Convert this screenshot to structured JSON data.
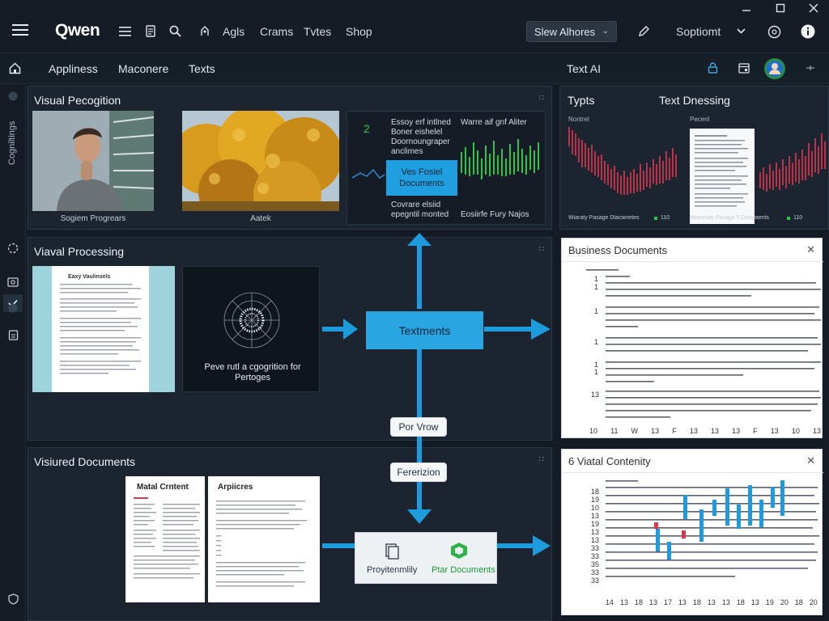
{
  "titlebar": {
    "brand": "Qwen",
    "menu": [
      "Agls",
      "Crams",
      "Tvtes",
      "Shop"
    ],
    "model_select": "Slew Alhores",
    "right_label": "Soptiomt",
    "window_controls": [
      "minimize-icon",
      "maximize-icon",
      "close-icon"
    ]
  },
  "subbar": {
    "tabs": [
      "Appliness",
      "Maconere",
      "Texts"
    ],
    "right_title": "Text AI"
  },
  "rail": {
    "vertical_label": "Cogniltings"
  },
  "panels": {
    "visual_recognition": {
      "title": "Visual Pecogition",
      "captions": [
        "Sogiem Progrears",
        "Aatek"
      ],
      "text_block_1": "Essoy erf intlned Boner eishelel Doornoungraper anclimes",
      "text_block_2": "Warre aif gnf Aliter",
      "highlight": "Ves Fosiel Documents",
      "text_block_3": "Covrare elsiid epegntil monted",
      "text_block_4": "Eosiirfe Fury Najos"
    },
    "types": {
      "title_left": "Typts",
      "title_right": "Text Dnessing",
      "left_header": "Nontrel",
      "right_header": "Pecenl",
      "left_footer": "Wiaraty Pasage Dlacwnetes",
      "right_footer": "Wianrraty Pasage 5 Docwaents",
      "left_footer_num": "110",
      "right_footer_num": "110"
    },
    "visual_processing": {
      "title": "Viaval Processing",
      "doc_title": "Eaxy Vaulinsels",
      "dark_caption": "Peve rutl a cgogrition for Pertoges"
    },
    "business_docs": {
      "title": "Business Documents",
      "line_numbers": [
        "1",
        "1",
        "1",
        "1",
        "1",
        "1",
        "13"
      ],
      "footer_numbers": [
        "10",
        "11",
        "W",
        "13",
        "F",
        "13",
        "13",
        "13",
        "F",
        "13",
        "10",
        "13"
      ]
    },
    "visual_documents": {
      "title": "Visiured Documents",
      "doc1_title": "Matal Crntent",
      "doc2_title": "Arpiicres"
    },
    "visual_content": {
      "title": "6 Viatal Contenity",
      "line_numbers": [
        "18",
        "19",
        "10",
        "13",
        "19",
        "13",
        "13",
        "33",
        "33",
        "35",
        "33",
        "33"
      ],
      "footer_numbers": [
        "14",
        "13",
        "18",
        "13",
        "17",
        "13",
        "18",
        "13",
        "13",
        "18",
        "13",
        "19",
        "20",
        "18",
        "20"
      ]
    }
  },
  "flow": {
    "center_box": "Textments",
    "pill_1": "Por Vrow",
    "pill_2": "Fererizion",
    "output_left": "Proyitenmlily",
    "output_right": "Ptar Documents"
  },
  "colors": {
    "accent": "#29a6e2",
    "arrow": "#1e9bdc",
    "background": "#141b24",
    "panel": "#1c2430",
    "chart_red": "#b8324a",
    "chart_green": "#2ec34a"
  }
}
